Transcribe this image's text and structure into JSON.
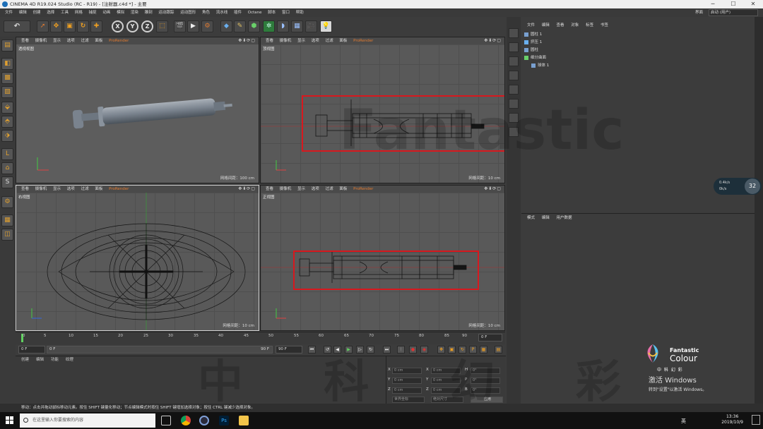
{
  "window": {
    "title": "CINEMA 4D R19.024 Studio (RC - R19) - [注射器.c4d *] - 主要",
    "controls": [
      "─",
      "☐",
      "✕"
    ]
  },
  "menubar": {
    "items": [
      "文件",
      "编辑",
      "创建",
      "选择",
      "工具",
      "网格",
      "捕捉",
      "动画",
      "模拟",
      "渲染",
      "雕刻",
      "运动跟踪",
      "运动图形",
      "角色",
      "流水线",
      "插件",
      "Octane",
      "脚本",
      "窗口",
      "帮助"
    ],
    "layout_label": "界面",
    "layout_value": "启动 (用户)"
  },
  "toolbar": {
    "axis_labels": [
      "X",
      "Y",
      "Z"
    ]
  },
  "viewports": [
    {
      "label": "透视视图",
      "menu": [
        "查看",
        "摄像机",
        "显示",
        "选项",
        "过滤",
        "面板",
        "ProRender"
      ],
      "grid_label": "网格间距：100 cm"
    },
    {
      "label": "顶视图",
      "menu": [
        "查看",
        "摄像机",
        "显示",
        "选项",
        "过滤",
        "面板",
        "ProRender"
      ],
      "grid_label": "网格间距：10 cm"
    },
    {
      "label": "右视图",
      "menu": [
        "查看",
        "摄像机",
        "显示",
        "选项",
        "过滤",
        "面板",
        "ProRender"
      ],
      "grid_label": "网格间距：10 cm"
    },
    {
      "label": "正视图",
      "menu": [
        "查看",
        "摄像机",
        "显示",
        "选项",
        "过滤",
        "面板",
        "ProRender"
      ],
      "grid_label": "网格间距：10 cm"
    }
  ],
  "timeline": {
    "ticks": [
      "0",
      "5",
      "10",
      "15",
      "20",
      "25",
      "30",
      "35",
      "40",
      "45",
      "50",
      "55",
      "60",
      "65",
      "70",
      "75",
      "80",
      "85",
      "90"
    ],
    "current_frame_end": "0 F",
    "start_field": "0 F",
    "range_start": "0 F",
    "range_end": "90 F",
    "end_field": "90 F"
  },
  "material_panel": {
    "menu": [
      "创建",
      "编辑",
      "功能",
      "纹理"
    ]
  },
  "coord_panel": {
    "rows": [
      {
        "a": "X",
        "av": "0 cm",
        "b": "X",
        "bv": "0 cm",
        "c": "H",
        "cv": "0°"
      },
      {
        "a": "Y",
        "av": "0 cm",
        "b": "Y",
        "bv": "0 cm",
        "c": "P",
        "cv": "0°"
      },
      {
        "a": "Z",
        "av": "0 cm",
        "b": "Z",
        "bv": "0 cm",
        "c": "B",
        "cv": "0°"
      }
    ],
    "mode1": "世界坐标",
    "mode2": "绝对尺寸",
    "apply": "应用"
  },
  "object_manager": {
    "menu": [
      "文件",
      "编辑",
      "查看",
      "对象",
      "标签",
      "书签"
    ],
    "objects": [
      "圆柱 1",
      "挤压 1",
      "圆柱",
      "细分曲面",
      "球体 1"
    ]
  },
  "attribute_manager": {
    "menu": [
      "模式",
      "编辑",
      "用户数据"
    ]
  },
  "perf_widget": {
    "percent": "32",
    "up": "0.4k/s",
    "down": "0k/s"
  },
  "statusbar": {
    "text": "移动：点击并拖动鼠标移动元素。按住 SHIFT 键量化移动；节点编辑模式时按住 SHIFT 键增加选择对象；按住 CTRL 键减少选择对象。"
  },
  "branding": {
    "logo_line1": "Fantastic",
    "logo_line2": "Colour",
    "logo_cn": "中 科 幻 彩",
    "activate_title": "激活 Windows",
    "activate_sub": "转到\"设置\"以激活 Windows。",
    "bg_word": "Fantastic",
    "bg_cn": "中 科 幻 彩"
  },
  "taskbar": {
    "search_placeholder": "在这里输入你要搜索的内容",
    "lang": "英",
    "time": "13:36",
    "date": "2019/10/9"
  },
  "colors": {
    "annotation_red": "#d8181e",
    "prorender_orange": "#e07a30",
    "viewport_bg": "#595959"
  }
}
